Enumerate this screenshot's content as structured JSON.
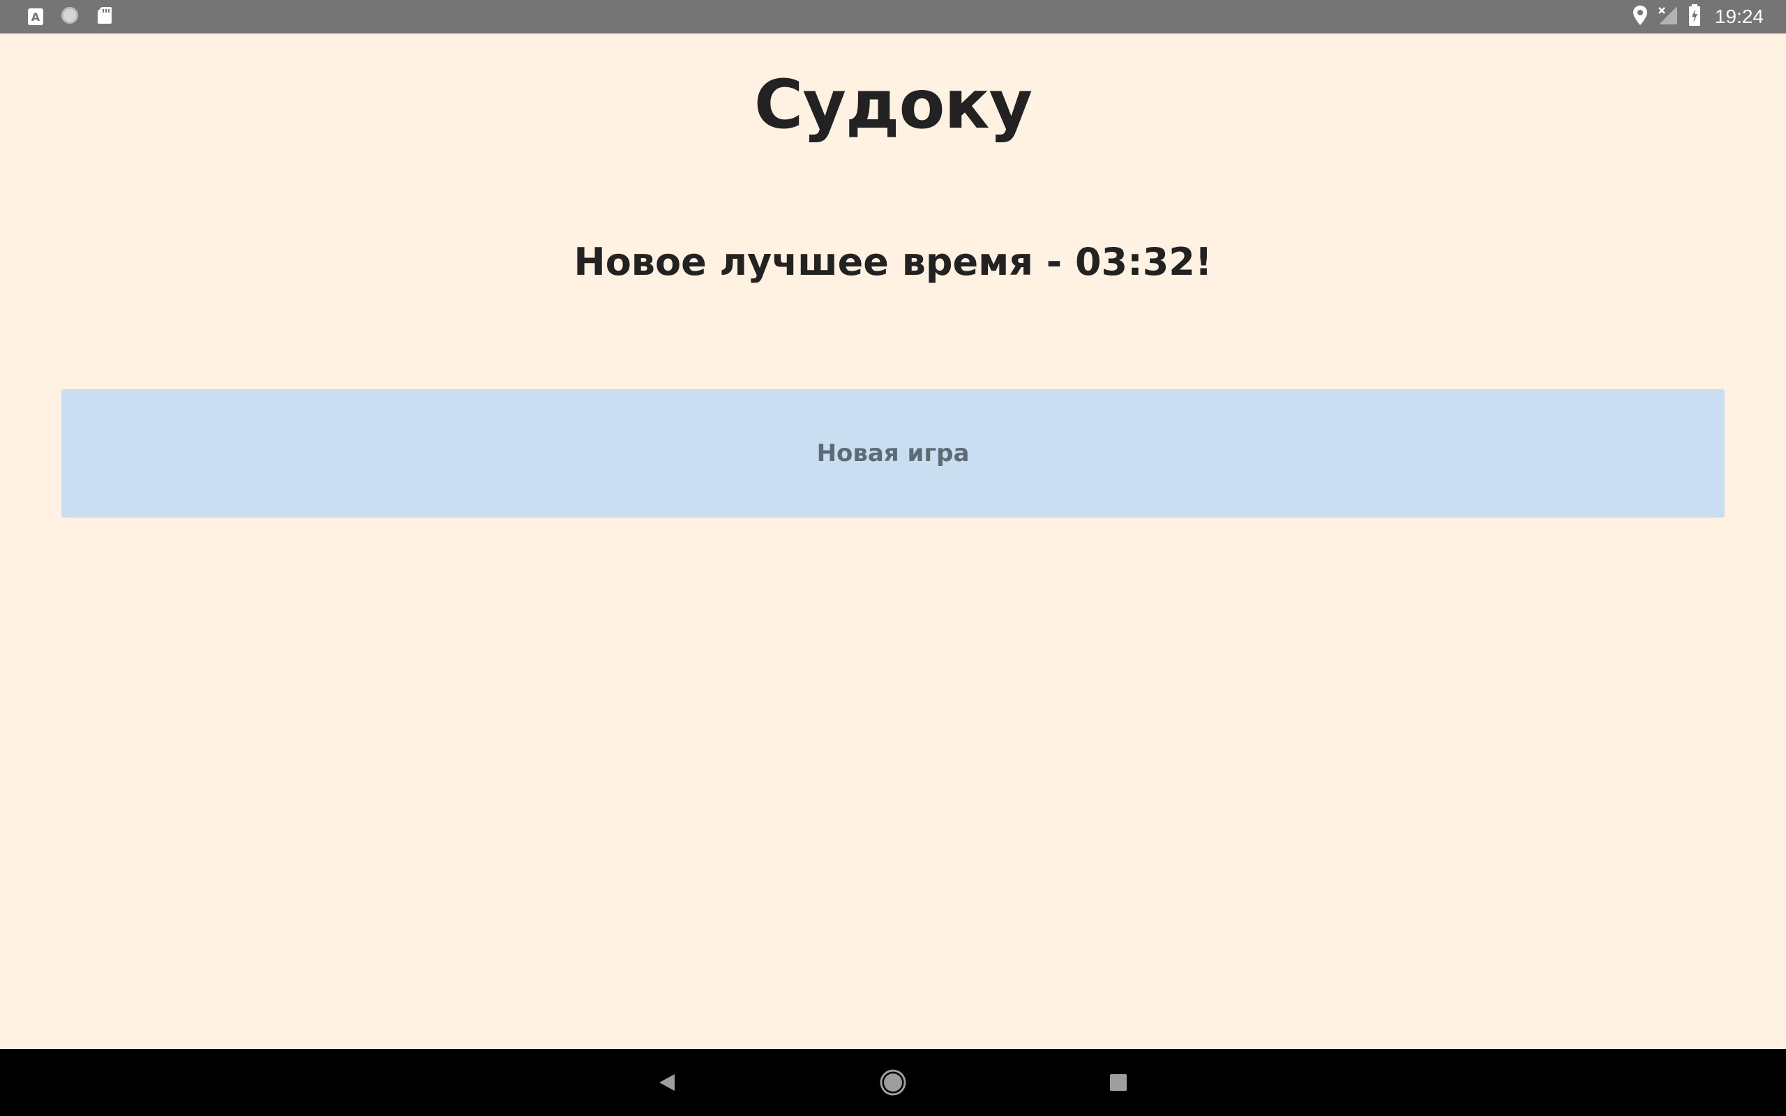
{
  "status_bar": {
    "left_icons": [
      "keyboard-a-icon",
      "circle-notification-icon",
      "sd-card-icon"
    ],
    "right_icons": [
      "location-pin-icon",
      "no-signal-icon",
      "battery-charging-icon"
    ],
    "time": "19:24",
    "keyboard_glyph": "A"
  },
  "main": {
    "title": "Судоку",
    "best_time_message": "Новое лучшее время - 03:32!",
    "new_game_label": "Новая игра"
  },
  "nav_bar": {
    "buttons": [
      "back-icon",
      "home-icon",
      "recents-icon"
    ]
  },
  "colors": {
    "background": "#fff2e2",
    "button": "#c9def0",
    "status_bar": "#757575",
    "nav_bar": "#000000",
    "text": "#222222"
  }
}
